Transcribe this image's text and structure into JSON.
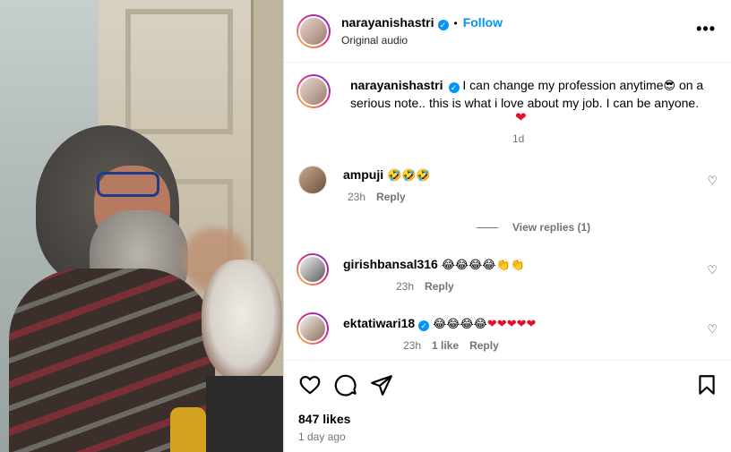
{
  "post": {
    "author": "narayanishastri",
    "follow_label": "Follow",
    "separator": "•",
    "audio": "Original audio",
    "more_label": "•••",
    "caption_line1": "I can change my profession anytime",
    "caption_emoji1": "😎",
    "caption_line2": "on a serious note.. this is what i love about my job. I can be anyone.",
    "caption_heart": "❤",
    "caption_time": "1d"
  },
  "comments": [
    {
      "user": "ampuji",
      "text": "🤣🤣🤣",
      "time": "23h",
      "likes": "",
      "reply": "Reply"
    },
    {
      "user": "girishbansal316",
      "text": "😂😂😂😂👏👏",
      "time": "23h",
      "likes": "",
      "reply": "Reply"
    },
    {
      "user": "ektatiwari18",
      "text": "😂😂😂😂❤❤❤❤❤",
      "time": "23h",
      "likes": "1 like",
      "reply": "Reply"
    }
  ],
  "view_replies": "View replies (1)",
  "footer": {
    "likes": "847 likes",
    "date": "1 day ago"
  },
  "colors": {
    "accent": "#0095f6",
    "muted": "#737373",
    "heart": "#e0102b"
  },
  "icons": [
    "heart-icon",
    "comment-icon",
    "share-icon",
    "bookmark-icon",
    "verified-icon",
    "more-icon"
  ]
}
